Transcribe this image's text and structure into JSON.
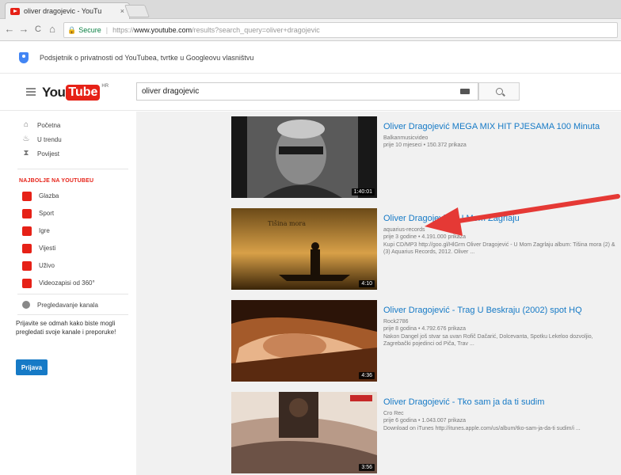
{
  "browser": {
    "tab_title": "oliver dragojevic - YouTu",
    "tab_close": "×",
    "nav_back": "←",
    "nav_forward": "→",
    "nav_reload": "C",
    "nav_home": "⌂",
    "secure_label": "Secure",
    "url_proto": "https://",
    "url_host": "www.youtube.com",
    "url_rest": "/results?search_query=oliver+dragojevic"
  },
  "notice": {
    "text": "Podsjetnik o privatnosti od YouTubea, tvrtke u Googleovu vlasništvu"
  },
  "masthead": {
    "logo_you": "You",
    "logo_tube": "Tube",
    "logo_region": "HR",
    "search_value": "oliver dragojevic"
  },
  "sidebar": {
    "items": [
      {
        "label": "Početna",
        "icon": "home-icon",
        "glyph": "⌂"
      },
      {
        "label": "U trendu",
        "icon": "flame-icon",
        "glyph": "♨"
      },
      {
        "label": "Povijest",
        "icon": "hourglass-icon",
        "glyph": "⧗"
      }
    ],
    "section_title": "NAJBOLJE NA YOUTUBEU",
    "categories": [
      {
        "label": "Glazba"
      },
      {
        "label": "Sport"
      },
      {
        "label": "Igre"
      },
      {
        "label": "Vijesti"
      },
      {
        "label": "Uživo"
      },
      {
        "label": "Videozapisi od 360°"
      }
    ],
    "browse_channels": "Pregledavanje kanala",
    "signin_text": "Prijavite se odmah kako biste mogli pregledati svoje kanale i preporuke!",
    "signin_button": "Prijava"
  },
  "results": [
    {
      "title": "Oliver Dragojević MEGA MIX HIT PJESAMA 100 Minuta",
      "channel": "Balkanmusicvideo",
      "stats": "prije 10 mjeseci • 150.372 prikaza",
      "description": "",
      "duration": "1:40:01"
    },
    {
      "title": "Oliver Dragojević - U Mom Zagrlaju",
      "channel": "aquarius-records",
      "stats": "prije 3 godine • 4.191.000 prikaza",
      "description": "Kupi CD/MP3 http://goo.gl/HlGrm Oliver Dragojević - U Mom Zagrlaju album: Tišina mora (2) & (3) Aquarius Records, 2012. Oliver ...",
      "duration": "4:10"
    },
    {
      "title": "Oliver Dragojević - Trag U Beskraju (2002) spot HQ",
      "channel": "Rock2786",
      "stats": "prije 8 godina • 4.792.676 prikaza",
      "description": "Nakon Dangel još stvar sa uvan Rofič Dačarić, Dolcevanta, Spotku Lekeloo dozvoljio, Zagrebački pojedinci od Piča, Trav ...",
      "duration": "4:36"
    },
    {
      "title": "Oliver Dragojević - Tko sam ja da ti sudim",
      "channel": "Cro Rec",
      "stats": "prije 6 godina • 1.043.007 prikaza",
      "description": "Download on iTunes http://itunes.apple.com/us/album/tko-sam-ja-da-ti sudim/i ...",
      "duration": "3:56"
    }
  ]
}
